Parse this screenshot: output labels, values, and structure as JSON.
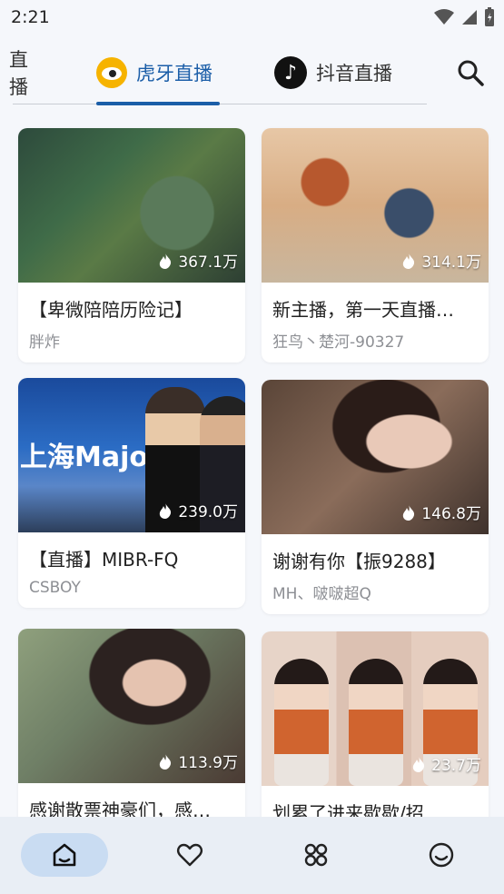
{
  "status": {
    "time": "2:21"
  },
  "tabs": {
    "partial_label": "直播",
    "huya_label": "虎牙直播",
    "douyin_label": "抖音直播"
  },
  "cards": [
    {
      "title": "【卑微陪陪历险记】",
      "streamer": "胖炸",
      "views": "367.1万"
    },
    {
      "title": "新主播，第一天直播…",
      "streamer": "狂鸟丶楚河-90327",
      "views": "314.1万"
    },
    {
      "title": "【直播】MIBR-FQ",
      "streamer": "CSBOY",
      "views": "239.0万",
      "thumb_text": "上海Major"
    },
    {
      "title": "谢谢有你【振9288】",
      "streamer": "MH、啵啵超Q",
      "views": "146.8万"
    },
    {
      "title": "感谢散票神豪们，感…",
      "streamer": "",
      "views": "113.9万"
    },
    {
      "title": "划累了进来歇歇/招…",
      "streamer": "",
      "views": "23.7万"
    }
  ],
  "colors": {
    "accent": "#1b5ea8",
    "nav_bg": "#e9eef5",
    "nav_active": "#c9dcf2"
  },
  "bottom_nav": [
    "home-icon",
    "heart-icon",
    "grid-icon",
    "smile-icon"
  ]
}
